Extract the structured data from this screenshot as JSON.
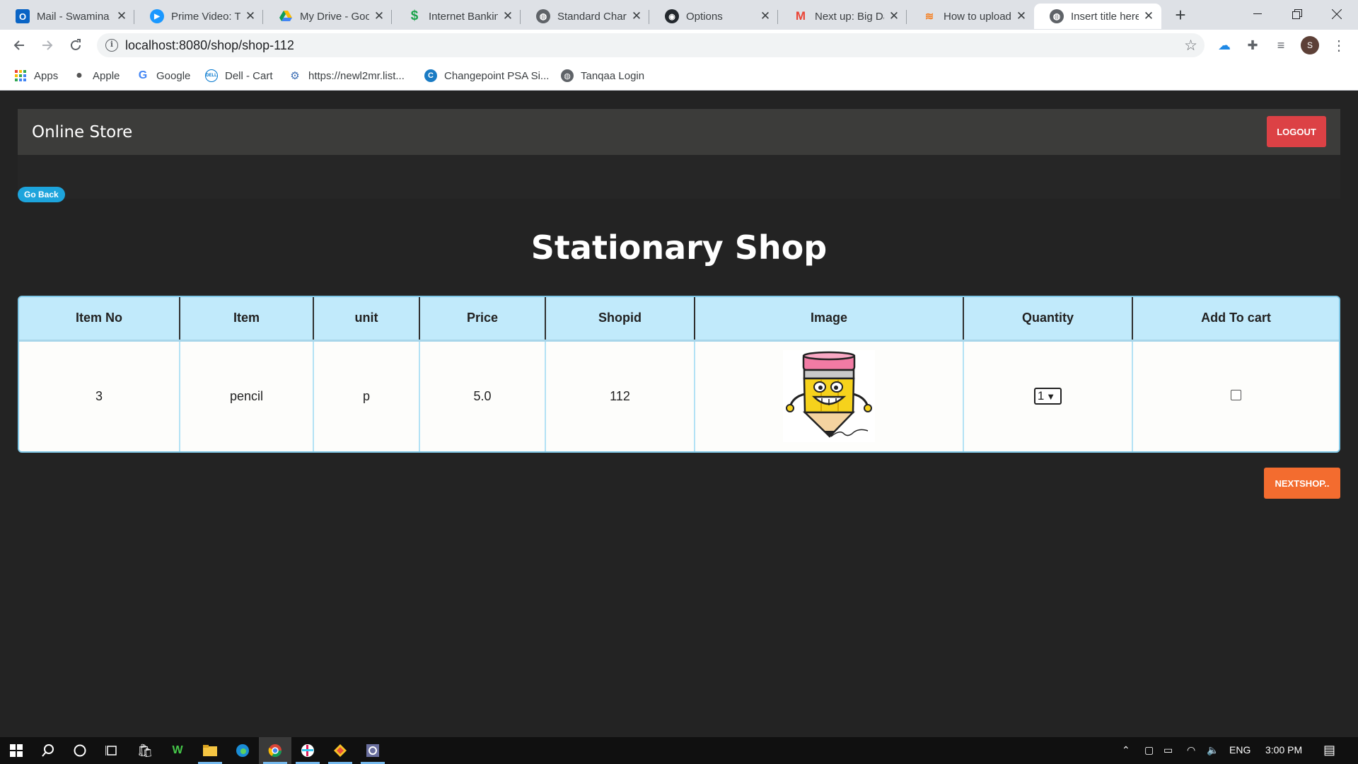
{
  "browser": {
    "tabs": [
      {
        "title": "Mail - Swamina",
        "icon": "outlook-icon"
      },
      {
        "title": "Prime Video: Th",
        "icon": "prime-video-icon"
      },
      {
        "title": "My Drive - Goo",
        "icon": "google-drive-icon"
      },
      {
        "title": "Internet Bankin",
        "icon": "bank-icon"
      },
      {
        "title": "Standard Chart",
        "icon": "globe-icon"
      },
      {
        "title": "Options",
        "icon": "github-icon"
      },
      {
        "title": "Next up: Big Da",
        "icon": "gmail-icon"
      },
      {
        "title": "How to upload",
        "icon": "stackoverflow-icon"
      },
      {
        "title": "Insert title here",
        "icon": "globe-icon",
        "active": true
      }
    ],
    "url": "localhost:8080/shop/shop-112",
    "profile_initial": "S",
    "bookmarks": [
      {
        "label": "Apps",
        "icon": "apps-grid-icon"
      },
      {
        "label": "Apple",
        "icon": "apple-icon"
      },
      {
        "label": "Google",
        "icon": "google-icon"
      },
      {
        "label": "Dell - Cart",
        "icon": "dell-icon"
      },
      {
        "label": "https://newl2mr.list...",
        "icon": "site-icon"
      },
      {
        "label": "Changepoint PSA Si...",
        "icon": "changepoint-icon"
      },
      {
        "label": "Tanqaa Login",
        "icon": "globe-icon"
      }
    ]
  },
  "navbar": {
    "brand": "Online Store",
    "logout_label": "LOGOUT"
  },
  "go_back_label": "Go Back",
  "heading": "Stationary Shop",
  "table": {
    "headers": [
      "Item No",
      "Item",
      "unit",
      "Price",
      "Shopid",
      "Image",
      "Quantity",
      "Add To cart"
    ],
    "rows": [
      {
        "item_no": "3",
        "item": "pencil",
        "unit": "p",
        "price": "5.0",
        "shopid": "112",
        "image": "pencil-cartoon-image",
        "quantity": "1",
        "add_to_cart": false
      }
    ]
  },
  "next_shop_label": "NEXTSHOP..",
  "taskbar": {
    "language": "ENG",
    "time": "3:00 PM"
  },
  "colors": {
    "page_bg": "#232323",
    "navbar_bg": "#3c3c3a",
    "logout_bg": "#dc4145",
    "goback_bg": "#1da4dc",
    "table_header_bg": "#c1eafb",
    "nextshop_bg": "#f36c2f"
  }
}
